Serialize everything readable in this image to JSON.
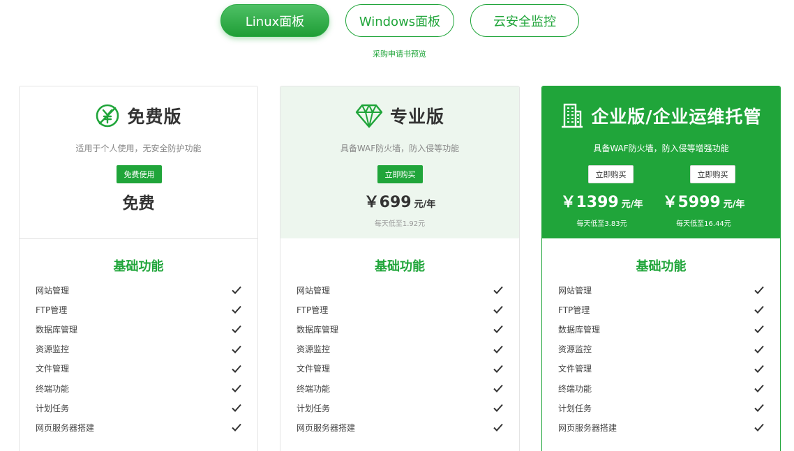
{
  "tabs": [
    {
      "label": "Linux面板",
      "active": true
    },
    {
      "label": "Windows面板",
      "active": false
    },
    {
      "label": "云安全监控",
      "active": false
    }
  ],
  "preview_link": "采购申请书预览",
  "accent_color": "#20a53a",
  "plans": {
    "free": {
      "icon": "no-yen-icon",
      "title": "免费版",
      "desc": "适用于个人使用，无安全防护功能",
      "button": "免费使用",
      "price": "免费"
    },
    "pro": {
      "icon": "diamond-icon",
      "title": "专业版",
      "desc": "具备WAF防火墙，防入侵等功能",
      "button": "立即购买",
      "price": "￥699",
      "unit": "元/年",
      "daily": "每天低至1.92元"
    },
    "enterprise": {
      "icon": "building-icon",
      "title": "企业版/企业运维托管",
      "desc": "具备WAF防火墙，防入侵等增强功能",
      "options": [
        {
          "button": "立即购买",
          "price": "￥1399",
          "unit": "元/年",
          "daily": "每天低至3.83元"
        },
        {
          "button": "立即购买",
          "price": "￥5999",
          "unit": "元/年",
          "daily": "每天低至16.44元"
        }
      ]
    }
  },
  "section_title": "基础功能",
  "features": [
    "网站管理",
    "FTP管理",
    "数据库管理",
    "资源监控",
    "文件管理",
    "终端功能",
    "计划任务",
    "网页服务器搭建"
  ]
}
